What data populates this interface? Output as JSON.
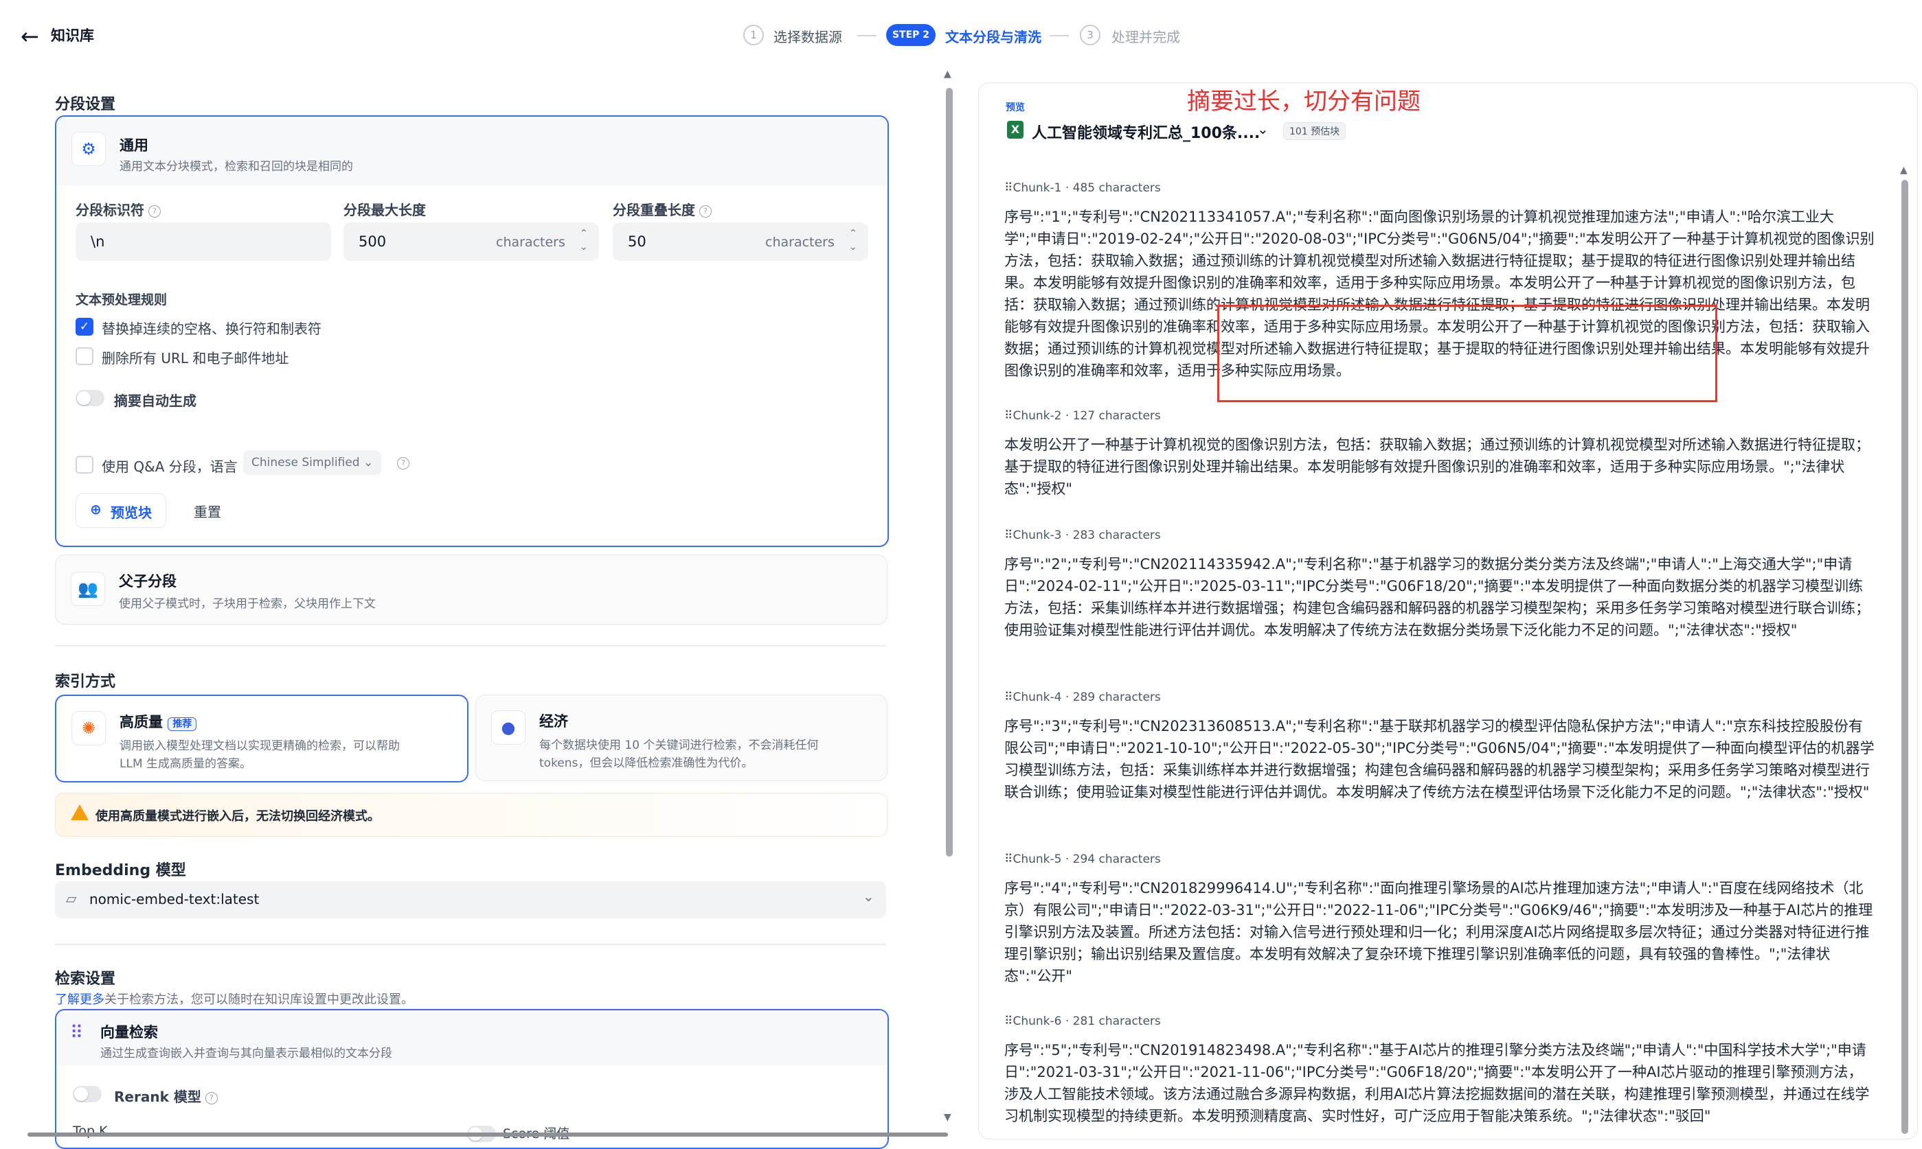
{
  "header": {
    "back_icon": "arrow-left-icon",
    "kb_title": "知识库",
    "steps": [
      {
        "num": "1",
        "label": "选择数据源"
      },
      {
        "num": "STEP 2",
        "label": "文本分段与清洗"
      },
      {
        "num": "3",
        "label": "处理并完成"
      }
    ]
  },
  "segment": {
    "section_title": "分段设置",
    "general": {
      "title": "通用",
      "desc": "通用文本分块模式，检索和召回的块是相同的"
    },
    "delimiter": {
      "label": "分段标识符",
      "value": "\\n"
    },
    "max_length": {
      "label": "分段最大长度",
      "value": "500",
      "unit": "characters"
    },
    "overlap": {
      "label": "分段重叠长度",
      "value": "50",
      "unit": "characters"
    },
    "preprocess_title": "文本预处理规则",
    "rule_replace": "替换掉连续的空格、换行符和制表符",
    "rule_remove_urls": "删除所有 URL 和电子邮件地址",
    "auto_summary": "摘要自动生成",
    "qa_label": "使用 Q&A 分段，语言",
    "qa_language": "Chinese Simplified",
    "preview_button": "预览块",
    "reset_button": "重置",
    "parent_child": {
      "title": "父子分段",
      "desc": "使用父子模式时，子块用于检索，父块用作上下文"
    }
  },
  "index": {
    "section_title": "索引方式",
    "high_quality": {
      "title": "高质量",
      "badge": "推荐",
      "desc_line1": "调用嵌入模型处理文档以实现更精确的检索，可以帮助",
      "desc_line2": "LLM 生成高质量的答案。"
    },
    "economy": {
      "title": "经济",
      "desc_line1": "每个数据块使用 10 个关键词进行检索，不会消耗任何",
      "desc_line2": "tokens，但会以降低检索准确性为代价。"
    },
    "warning": "使用高质量模式进行嵌入后，无法切换回经济模式。"
  },
  "embedding": {
    "section_title": "Embedding 模型",
    "model": "nomic-embed-text:latest"
  },
  "retrieval": {
    "section_title": "检索设置",
    "learn_more": "了解更多",
    "desc": "关于检索方法，您可以随时在知识库设置中更改此设置。",
    "vector": {
      "title": "向量检索",
      "desc": "通过生成查询嵌入并查询与其向量表示最相似的文本分段"
    },
    "rerank": "Rerank 模型",
    "topk_partial": "Top K",
    "score_partial": "Score 阈值"
  },
  "preview": {
    "tag": "预览",
    "annotation": "摘要过长，切分有问题",
    "file_name": "人工智能领域专利汇总_100条....",
    "estimate": "101 预估块",
    "chunks": [
      {
        "head": "Chunk-1 · 485 characters",
        "text": "序号\":\"1\";\"专利号\":\"CN202113341057.A\";\"专利名称\":\"面向图像识别场景的计算机视觉推理加速方法\";\"申请人\":\"哈尔滨工业大学\";\"申请日\":\"2019-02-24\";\"公开日\":\"2020-08-03\";\"IPC分类号\":\"G06N5/04\";\"摘要\":\"本发明公开了一种基于计算机视觉的图像识别方法，包括：获取输入数据；通过预训练的计算机视觉模型对所述输入数据进行特征提取；基于提取的特征进行图像识别处理并输出结果。本发明能够有效提升图像识别的准确率和效率，适用于多种实际应用场景。本发明公开了一种基于计算机视觉的图像识别方法，包括：获取输入数据；通过预训练的计算机视觉模型对所述输入数据进行特征提取；基于提取的特征进行图像识别处理并输出结果。本发明能够有效提升图像识别的准确率和效率，适用于多种实际应用场景。本发明公开了一种基于计算机视觉的图像识别方法，包括：获取输入数据；通过预训练的计算机视觉模型对所述输入数据进行特征提取；基于提取的特征进行图像识别处理并输出结果。本发明能够有效提升图像识别的准确率和效率，适用于多种实际应用场景。"
      },
      {
        "head": "Chunk-2 · 127 characters",
        "text": "本发明公开了一种基于计算机视觉的图像识别方法，包括：获取输入数据；通过预训练的计算机视觉模型对所述输入数据进行特征提取；基于提取的特征进行图像识别处理并输出结果。本发明能够有效提升图像识别的准确率和效率，适用于多种实际应用场景。\";\"法律状态\":\"授权\""
      },
      {
        "head": "Chunk-3 · 283 characters",
        "text": "序号\":\"2\";\"专利号\":\"CN202114335942.A\";\"专利名称\":\"基于机器学习的数据分类分类方法及终端\";\"申请人\":\"上海交通大学\";\"申请日\":\"2024-02-11\";\"公开日\":\"2025-03-11\";\"IPC分类号\":\"G06F18/20\";\"摘要\":\"本发明提供了一种面向数据分类的机器学习模型训练方法，包括：采集训练样本并进行数据增强；构建包含编码器和解码器的机器学习模型架构；采用多任务学习策略对模型进行联合训练；使用验证集对模型性能进行评估并调优。本发明解决了传统方法在数据分类场景下泛化能力不足的问题。\";\"法律状态\":\"授权\""
      },
      {
        "head": "Chunk-4 · 289 characters",
        "text": "序号\":\"3\";\"专利号\":\"CN202313608513.A\";\"专利名称\":\"基于联邦机器学习的模型评估隐私保护方法\";\"申请人\":\"京东科技控股股份有限公司\";\"申请日\":\"2021-10-10\";\"公开日\":\"2022-05-30\";\"IPC分类号\":\"G06N5/04\";\"摘要\":\"本发明提供了一种面向模型评估的机器学习模型训练方法，包括：采集训练样本并进行数据增强；构建包含编码器和解码器的机器学习模型架构；采用多任务学习策略对模型进行联合训练；使用验证集对模型性能进行评估并调优。本发明解决了传统方法在模型评估场景下泛化能力不足的问题。\";\"法律状态\":\"授权\""
      },
      {
        "head": "Chunk-5 · 294 characters",
        "text": "序号\":\"4\";\"专利号\":\"CN201829996414.U\";\"专利名称\":\"面向推理引擎场景的AI芯片推理加速方法\";\"申请人\":\"百度在线网络技术（北京）有限公司\";\"申请日\":\"2022-03-31\";\"公开日\":\"2022-11-06\";\"IPC分类号\":\"G06K9/46\";\"摘要\":\"本发明涉及一种基于AI芯片的推理引擎识别方法及装置。所述方法包括：对输入信号进行预处理和归一化；利用深度AI芯片网络提取多层次特征；通过分类器对特征进行推理引擎识别；输出识别结果及置信度。本发明有效解决了复杂环境下推理引擎识别准确率低的问题，具有较强的鲁棒性。\";\"法律状态\":\"公开\""
      },
      {
        "head": "Chunk-6 · 281 characters",
        "text": "序号\":\"5\";\"专利号\":\"CN201914823498.A\";\"专利名称\":\"基于AI芯片的推理引擎分类方法及终端\";\"申请人\":\"中国科学技术大学\";\"申请日\":\"2021-03-31\";\"公开日\":\"2021-11-06\";\"IPC分类号\":\"G06F18/20\";\"摘要\":\"本发明公开了一种AI芯片驱动的推理引擎预测方法，涉及人工智能技术领域。该方法通过融合多源异构数据，利用AI芯片算法挖掘数据间的潜在关联，构建推理引擎预测模型，并通过在线学习机制实现模型的持续更新。本发明预测精度高、实时性好，可广泛应用于智能决策系统。\";\"法律状态\":\"驳回\""
      }
    ]
  }
}
